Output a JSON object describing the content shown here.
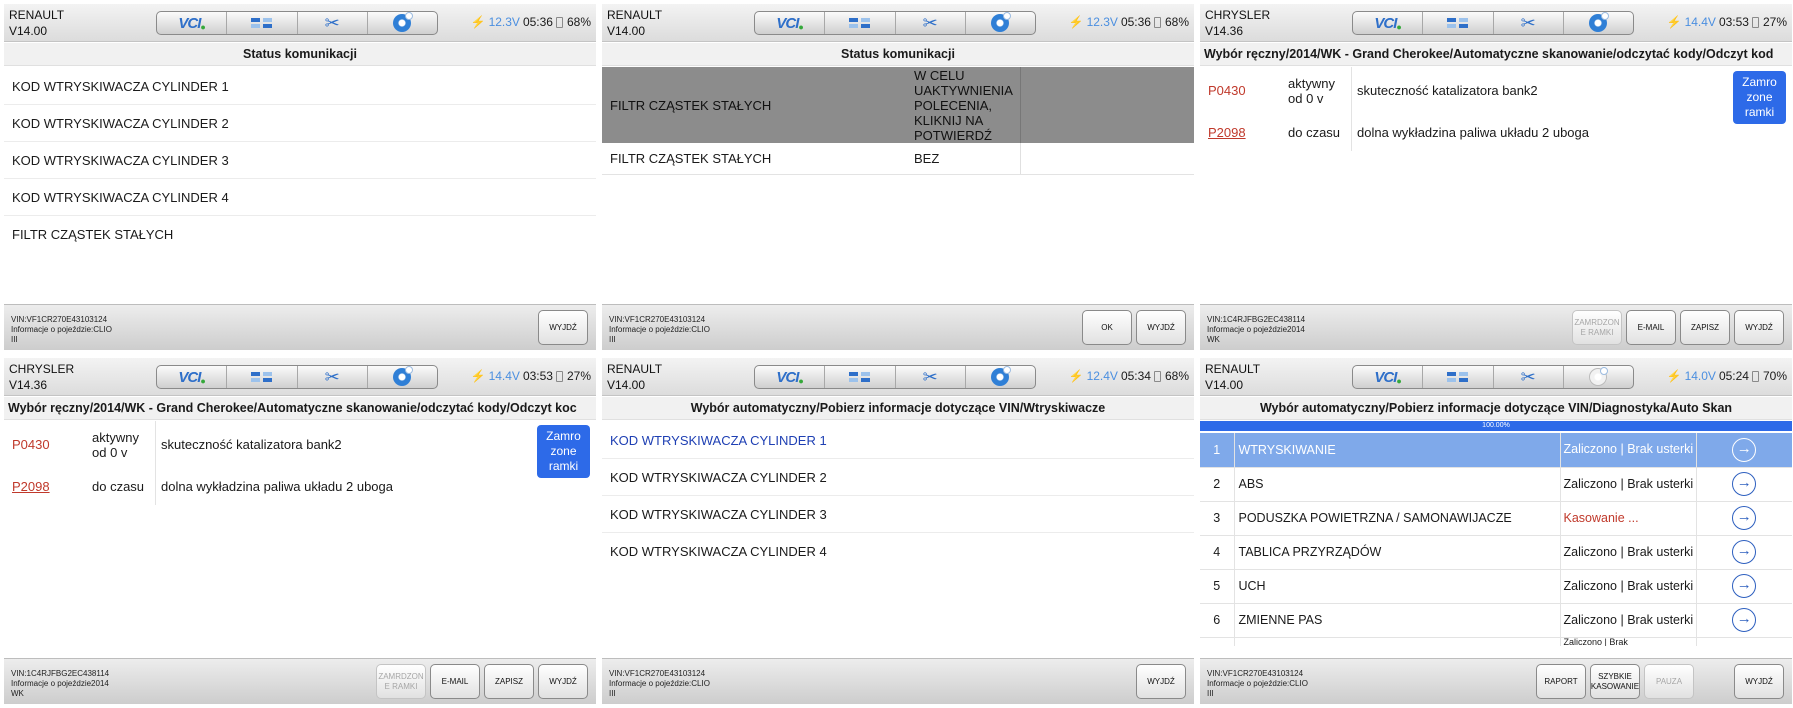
{
  "panels": [
    {
      "brand": "RENAULT",
      "version": "V14.00",
      "volt": "12.3V",
      "time": "05:36",
      "battery": "68%",
      "title": "Status komunikacji",
      "items": [
        "KOD WTRYSKIWACZA CYLINDER 1",
        "KOD WTRYSKIWACZA CYLINDER 2",
        "KOD WTRYSKIWACZA CYLINDER 3",
        "KOD WTRYSKIWACZA CYLINDER 4",
        "FILTR CZĄSTEK STAŁYCH"
      ],
      "vin": "VIN:VF1CR270E43103124",
      "info": "Informacje o pojeździe:CLIO",
      "model": "III",
      "buttons": [
        "WYJDŹ"
      ]
    },
    {
      "brand": "RENAULT",
      "version": "V14.00",
      "volt": "12.3V",
      "time": "05:36",
      "battery": "68%",
      "title": "Status komunikacji",
      "rows": [
        {
          "name": "FILTR CZĄSTEK STAŁYCH",
          "value": "W CELU UAKTYWNIENIA POLECENIA, KLIKNIJ NA POTWIERDŹ"
        },
        {
          "name": "FILTR CZĄSTEK STAŁYCH",
          "value": "BEZ"
        }
      ],
      "vin": "VIN:VF1CR270E43103124",
      "info": "Informacje o pojeździe:CLIO",
      "model": "III",
      "buttons": [
        "OK",
        "WYJDŹ"
      ]
    },
    {
      "brand": "CHRYSLER",
      "version": "V14.36",
      "volt": "14.4V",
      "time": "03:53",
      "battery": "27%",
      "title": "Wybór ręczny/2014/WK - Grand Cherokee/Automatyczne skanowanie/odczytać kody/Odczyt kod",
      "codes": [
        {
          "code": "P0430",
          "status": "aktywny od 0 v",
          "desc": "skuteczność katalizatora bank2"
        },
        {
          "code": "P2098",
          "status": "do czasu",
          "desc": "dolna wykładzina paliwa układu 2 uboga"
        }
      ],
      "frozen": "Zamro zone ramki",
      "vin": "VIN:1C4RJFBG2EC438114",
      "info": "Informacje o pojeździe2014",
      "model": "WK",
      "buttons": [
        "ZAMRDZON E RAMKI",
        "E-MAIL",
        "ZAPISZ",
        "WYJDŹ"
      ]
    },
    {
      "brand": "CHRYSLER",
      "version": "V14.36",
      "volt": "14.4V",
      "time": "03:53",
      "battery": "27%",
      "title": "Wybór ręczny/2014/WK - Grand Cherokee/Automatyczne skanowanie/odczytać kody/Odczyt koc",
      "codes": [
        {
          "code": "P0430",
          "status": "aktywny od 0 v",
          "desc": "skuteczność katalizatora bank2"
        },
        {
          "code": "P2098",
          "status": "do czasu",
          "desc": "dolna wykładzina paliwa układu 2 uboga"
        }
      ],
      "frozen": "Zamro zone ramki",
      "vin": "VIN:1C4RJFBG2EC438114",
      "info": "Informacje o pojeździe2014",
      "model": "WK",
      "buttons": [
        "ZAMRDZON E RAMKI",
        "E-MAIL",
        "ZAPISZ",
        "WYJDŹ"
      ]
    },
    {
      "brand": "RENAULT",
      "version": "V14.00",
      "volt": "12.4V",
      "time": "05:34",
      "battery": "68%",
      "title": "Wybór automatyczny/Pobierz informacje dotyczące VIN/Wtryskiwacze",
      "items": [
        "KOD WTRYSKIWACZA CYLINDER 1",
        "KOD WTRYSKIWACZA CYLINDER 2",
        "KOD WTRYSKIWACZA CYLINDER 3",
        "KOD WTRYSKIWACZA CYLINDER 4"
      ],
      "vin": "VIN:VF1CR270E43103124",
      "info": "Informacje o pojeździe:CLIO",
      "model": "III",
      "buttons": [
        "WYJDŹ"
      ]
    },
    {
      "brand": "RENAULT",
      "version": "V14.00",
      "volt": "14.0V",
      "time": "05:24",
      "battery": "70%",
      "title": "Wybór automatyczny/Pobierz informacje dotyczące VIN/Diagnostyka/Auto Skan",
      "progress": "100.00%",
      "systems": [
        {
          "n": "1",
          "name": "WTRYSKIWANIE",
          "result": "Zaliczono | Brak usterki"
        },
        {
          "n": "2",
          "name": "ABS",
          "result": "Zaliczono | Brak usterki"
        },
        {
          "n": "3",
          "name": "PODUSZKA POWIETRZNA / SAMONAWIJACZE",
          "result": "Kasowanie ..."
        },
        {
          "n": "4",
          "name": "TABLICA PRZYRZĄDÓW",
          "result": "Zaliczono | Brak usterki"
        },
        {
          "n": "5",
          "name": "UCH",
          "result": "Zaliczono | Brak usterki"
        },
        {
          "n": "6",
          "name": "ZMIENNE PAS",
          "result": "Zaliczono | Brak usterki"
        }
      ],
      "partial_result": "Zaliczono | Brak",
      "vin": "VIN:VF1CR270E43103124",
      "info": "Informacje o pojeździe:CLIO",
      "model": "III",
      "buttons": [
        "RAPORT",
        "SZYBKIE KASOWANIE",
        "PAUZA",
        "WYJDŹ"
      ]
    }
  ],
  "icons": [
    "vcl-icon",
    "module-icon",
    "scissors-icon",
    "disc-icon",
    "bolt-icon",
    "battery-icon",
    "arrow-circle-icon"
  ],
  "colors": {
    "accent": "#2d6ae8",
    "highlight_row": "#7fa9ea",
    "code_red": "#c0392b",
    "voltage": "#4b8fe0",
    "header_grey": "#8c8c8c"
  }
}
